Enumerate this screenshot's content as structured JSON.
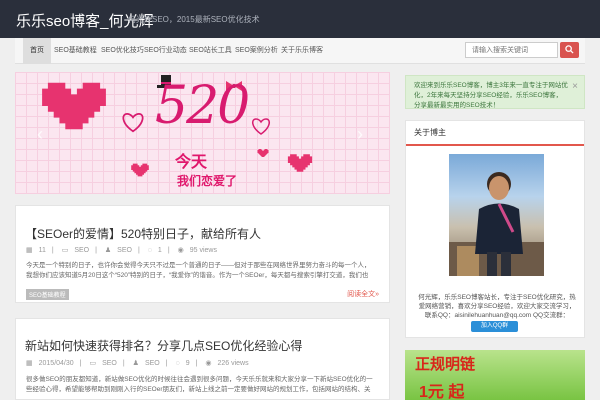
{
  "site": {
    "title": "乐乐seo博客_何光辉",
    "tagline": "何光辉SEO，2015最新SEO优化技术"
  },
  "nav": {
    "items": [
      {
        "label": "首页"
      },
      {
        "label": "SEO基础教程"
      },
      {
        "label": "SEO优化技巧"
      },
      {
        "label": "SEO行业动态"
      },
      {
        "label": "SEO站长工具"
      },
      {
        "label": "SEO案例分析"
      },
      {
        "label": "关于乐乐博客"
      }
    ],
    "search_placeholder": "请输入搜索关键词"
  },
  "banner": {
    "big_text": "520",
    "line1": "今天",
    "line2": "我们恋爱了",
    "prev_glyph": "‹",
    "next_glyph": "›"
  },
  "posts": [
    {
      "title": "【SEOer的爱情】520特别日子，献给所有人",
      "date": "11",
      "category": "SEO",
      "author": "SEO",
      "comments": "1",
      "views": "95 views",
      "excerpt": "今天是一个特别的日子，也许你会觉得今天只不过是一个普通的日子——但对于那些在网络世界里努力奋斗的每一个人，我想你们应该知道5月20日这个“520”特别的日子，“我爱你”的谐音。作为一个SEOer，每天都与搜索引擎打交道，我们也同样需要爱情，今天我想把祝福送给每一个在SEO路上默默坚持的朋友们……",
      "tag": "SEO基础教程",
      "readmore": "阅读全文»"
    },
    {
      "title": "新站如何快速获得排名？分享几点SEO优化经验心得",
      "date": "2015/04/30",
      "category": "SEO",
      "author": "SEO",
      "comments": "9",
      "views": "226 views",
      "excerpt": "很多做SEO的朋友都知道，新站做SEO优化的时候往往会遇到很多问题，今天乐乐就来和大家分享一下新站SEO优化的一些经验心得，希望能够帮助到刚刚入行的SEOer朋友们，新站上线之前一定要做好网站的规划工作，包括网站的结构、关键词的布局、内容的规划等SEO基础工作，这些都是非常重要的……"
    }
  ],
  "alert": {
    "text": "欢迎来到乐乐SEO博客，博主3年来一直专注于网站优化，2年来每天坚持分享SEO经验，乐乐SEO博客，分享最新最实用的SEO技术！",
    "close": "×"
  },
  "widget": {
    "title": "关于博主",
    "text": "何光辉，乐乐SEO博客站长，专注于SEO优化研究，热爱网络营销，喜欢分享SEO经验，欢迎大家交流学习，联系QQ：aisinilehuanhuan@qq.com QQ交流群：",
    "qq_button": "加入QQ群"
  },
  "ad": {
    "text": "正规明链",
    "price": "1元 起"
  },
  "colors": {
    "topbar": "#2a2f3b",
    "accent": "#e2574c",
    "search_button": "#d9534f"
  }
}
